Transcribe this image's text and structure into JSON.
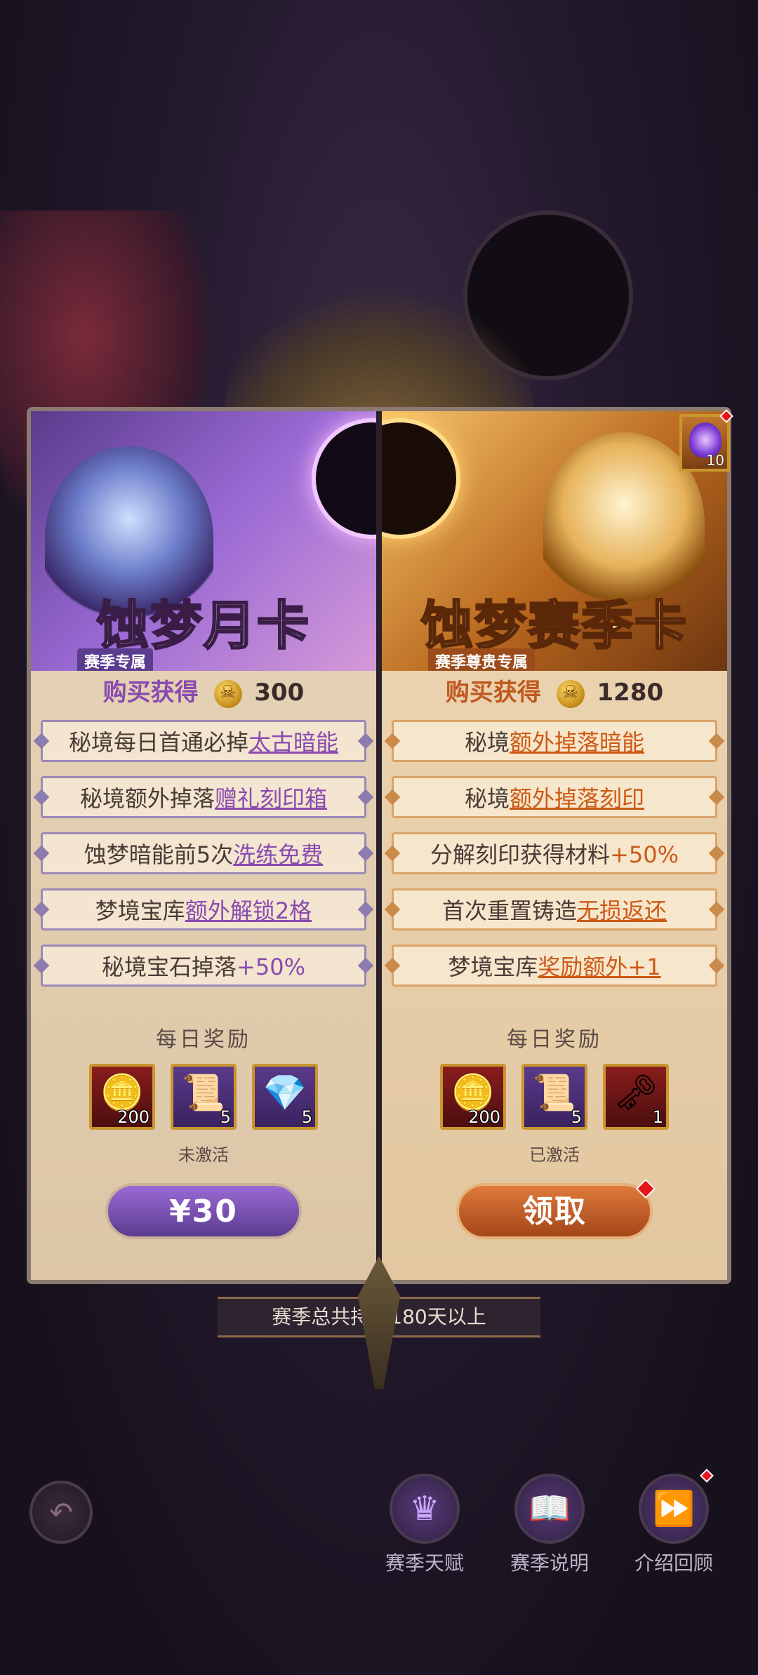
{
  "season_note": "赛季总共持续180天以上",
  "corner_item": {
    "count": "10",
    "icon": "purple-flame-icon"
  },
  "left_card": {
    "title": "蚀梦月卡",
    "subtitle": "赛季专属",
    "purchase_label": "购买获得",
    "purchase_amount": "300",
    "features": [
      {
        "plain": "秘境每日首通必掉",
        "highlight": "太古暗能"
      },
      {
        "plain": "秘境额外掉落",
        "highlight": "赠礼刻印箱"
      },
      {
        "plain": "蚀梦暗能前5次",
        "highlight": "洗练免费"
      },
      {
        "plain": "梦境宝库",
        "highlight": "额外解锁2格"
      },
      {
        "plain": "秘境宝石掉落",
        "highlight": "+50%"
      }
    ],
    "daily_label": "每日奖励",
    "rewards": [
      {
        "icon": "skull-coin-icon",
        "count": "200"
      },
      {
        "icon": "purple-scroll-icon",
        "count": "5"
      },
      {
        "icon": "purple-gem-icon",
        "count": "5"
      }
    ],
    "status": "未激活",
    "button_label": "¥30"
  },
  "right_card": {
    "title": "蚀梦赛季卡",
    "subtitle": "赛季尊贵专属",
    "purchase_label": "购买获得",
    "purchase_amount": "1280",
    "features": [
      {
        "plain": "秘境",
        "highlight": "额外掉落暗能"
      },
      {
        "plain": "秘境",
        "highlight": "额外掉落刻印"
      },
      {
        "plain": "分解刻印获得材料",
        "highlight": "+50%"
      },
      {
        "plain": "首次重置铸造",
        "highlight": "无损返还"
      },
      {
        "plain": "梦境宝库",
        "highlight": "奖励额外+1"
      }
    ],
    "daily_label": "每日奖励",
    "rewards": [
      {
        "icon": "skull-coin-icon",
        "count": "200"
      },
      {
        "icon": "purple-scroll-icon",
        "count": "5"
      },
      {
        "icon": "key-icon",
        "count": "1"
      }
    ],
    "status": "已激活",
    "button_label": "领取"
  },
  "bottom_nav": [
    {
      "label": "赛季天赋",
      "icon": "talent-icon"
    },
    {
      "label": "赛季说明",
      "icon": "info-icon"
    },
    {
      "label": "介绍回顾",
      "icon": "replay-icon"
    }
  ],
  "back_icon": "back-arrow-icon"
}
